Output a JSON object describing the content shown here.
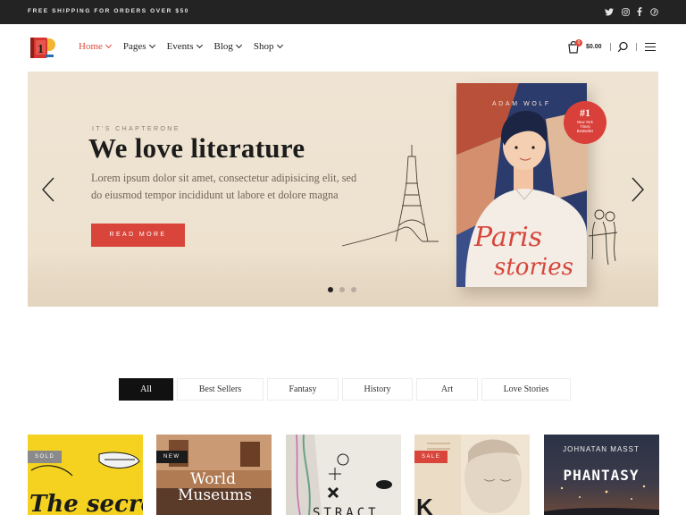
{
  "topbar": {
    "announcement": "FREE SHIPPING FOR ORDERS OVER $50",
    "social_icons": [
      "twitter-icon",
      "instagram-icon",
      "facebook-icon",
      "pinterest-icon"
    ]
  },
  "header": {
    "logo_icon": "book-logo-icon",
    "nav": [
      {
        "label": "Home",
        "active": true
      },
      {
        "label": "Pages"
      },
      {
        "label": "Events"
      },
      {
        "label": "Blog"
      },
      {
        "label": "Shop"
      }
    ],
    "cart_count": "0",
    "cart_total": "$0.00"
  },
  "hero": {
    "eyebrow": "IT'S CHAPTERONE",
    "title": "We love literature",
    "text": "Lorem ipsum dolor sit amet, consectetur adipisicing elit, sed do eiusmod tempor incididunt ut labore et dolore magna",
    "button": "READ MORE",
    "book_author": "ADAM WOLF",
    "book_title_line1": "Paris",
    "book_title_line2": "stories",
    "badge_num": "#1",
    "badge_line1": "New York",
    "badge_line2": "Times",
    "badge_line3": "Bestseller",
    "slide_count": 3,
    "active_slide": 1
  },
  "filters": {
    "tabs": [
      {
        "label": "All",
        "active": true
      },
      {
        "label": "Best Sellers"
      },
      {
        "label": "Fantasy"
      },
      {
        "label": "History"
      },
      {
        "label": "Art"
      },
      {
        "label": "Love Stories"
      }
    ]
  },
  "products": [
    {
      "label": "SOLD",
      "cover_text": "The secrets"
    },
    {
      "label": "NEW",
      "cover_text_1": "World",
      "cover_text_2": "Museums"
    },
    {
      "label": "",
      "cover_text": "STRACT"
    },
    {
      "label": "SALE",
      "cover_text": "K"
    },
    {
      "label": "",
      "cover_author": "JOHNATAN MASST",
      "cover_text": "PHANTASY"
    }
  ],
  "colors": {
    "accent": "#d9453a",
    "topbar": "#232323",
    "hero_bg": "#efe4d3"
  }
}
